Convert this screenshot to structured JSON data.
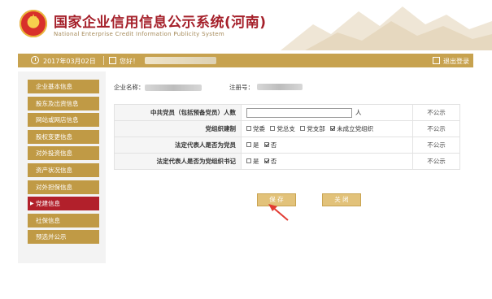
{
  "header": {
    "title_cn": "国家企业信用信息公示系统(河南)",
    "title_en": "National Enterprise Credit Information Publicity System"
  },
  "topbar": {
    "date": "2017年03月02日",
    "greeting": "您好！",
    "logout": "退出登录",
    "color": "#c7a24f"
  },
  "sidebar": {
    "items": [
      {
        "label": "企业基本信息"
      },
      {
        "label": "股东及出资信息"
      },
      {
        "label": "网站或网店信息"
      },
      {
        "label": "股权变更信息"
      },
      {
        "label": "对外投资信息"
      },
      {
        "label": "资产状况信息"
      },
      {
        "label": "对外担保信息"
      },
      {
        "label": "党建信息",
        "active": true
      },
      {
        "label": "社保信息"
      },
      {
        "label": "预选并公示"
      }
    ]
  },
  "company": {
    "name_label": "企业名称：",
    "reg_label": "注册号："
  },
  "form": {
    "rows": [
      {
        "label": "中共党员（包括预备党员）人数",
        "unit": "人",
        "input_value": "",
        "publicity": "不公示"
      },
      {
        "label": "党组织建制",
        "options": [
          {
            "label": "党委",
            "checked": false
          },
          {
            "label": "党总支",
            "checked": false
          },
          {
            "label": "党支部",
            "checked": false
          },
          {
            "label": "未成立党组织",
            "checked": true
          }
        ],
        "publicity": "不公示"
      },
      {
        "label": "法定代表人是否为党员",
        "options": [
          {
            "label": "是",
            "checked": false
          },
          {
            "label": "否",
            "checked": true
          }
        ],
        "publicity": "不公示"
      },
      {
        "label": "法定代表人是否为党组织书记",
        "options": [
          {
            "label": "是",
            "checked": false
          },
          {
            "label": "否",
            "checked": true
          }
        ],
        "publicity": "不公示"
      }
    ]
  },
  "buttons": {
    "save": "保 存",
    "close": "关 闭"
  },
  "colors": {
    "brand_red": "#b2202b",
    "gold": "#c09a45",
    "button": "#e2c27a",
    "arrow": "#e23b32"
  }
}
